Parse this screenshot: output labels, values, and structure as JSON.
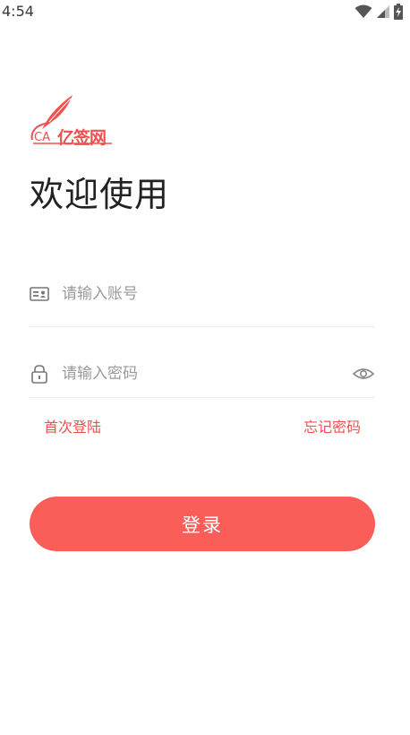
{
  "status_bar": {
    "time": "4:54",
    "icons": [
      "wifi-icon",
      "cellular-signal-icon",
      "battery-charging-icon"
    ]
  },
  "logo": {
    "ca": "CA",
    "name": "亿签网"
  },
  "welcome_title": "欢迎使用",
  "account": {
    "placeholder": "请输入账号",
    "value": "",
    "icon": "id-card-icon"
  },
  "password": {
    "placeholder": "请输入密码",
    "value": "",
    "icon": "lock-icon",
    "toggle_icon": "eye-icon"
  },
  "links": {
    "first_login": "首次登陆",
    "forgot_password": "忘记密码"
  },
  "login_button": "登录",
  "colors": {
    "accent": "#f0504f",
    "button": "#fb5d58",
    "divider": "#ececec",
    "placeholder": "#9a9a9a"
  }
}
